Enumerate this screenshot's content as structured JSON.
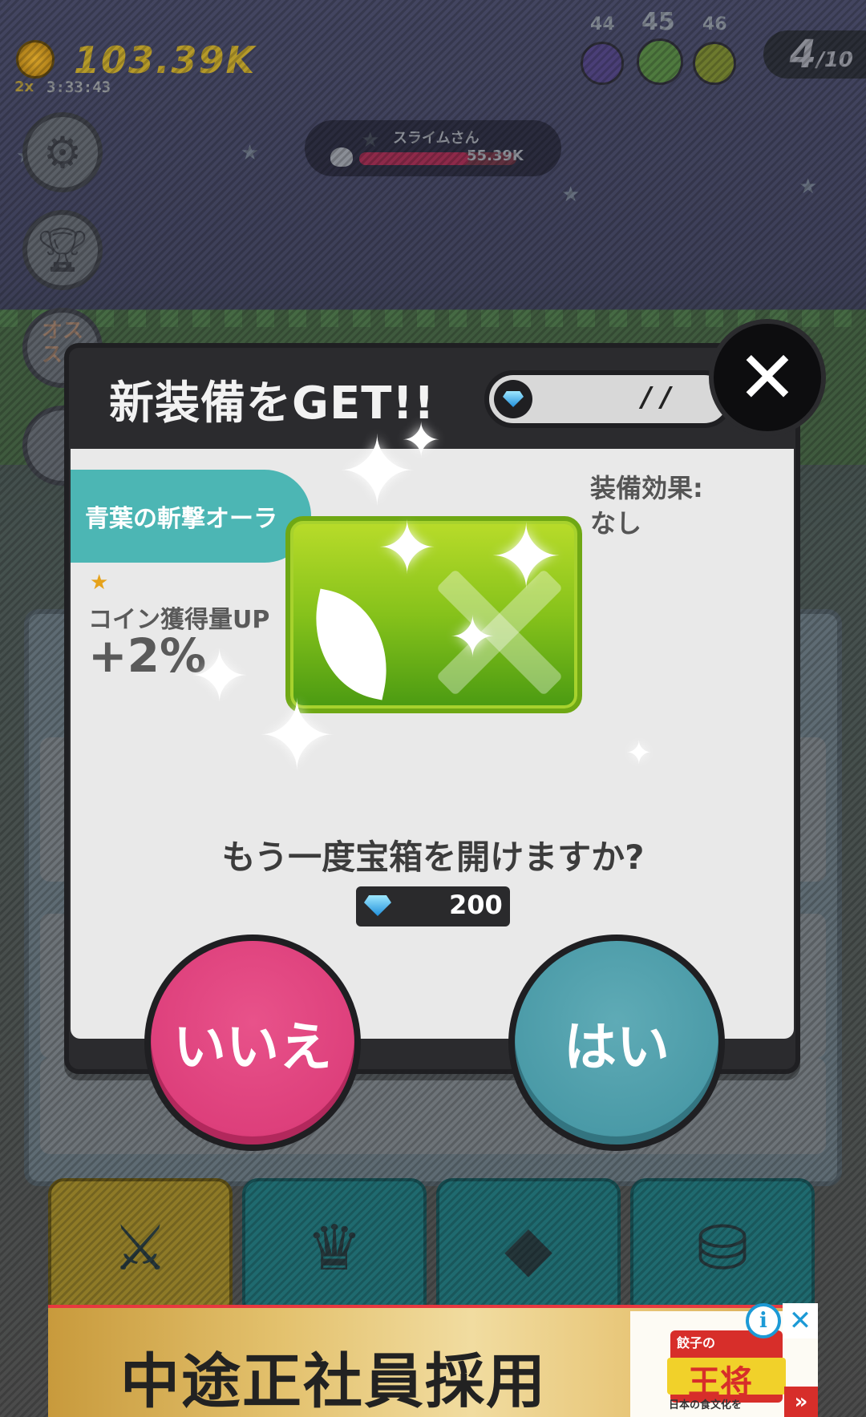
{
  "hud": {
    "coins": "103.39K",
    "multiplier": "2x",
    "timer": "3:33:43",
    "stages": [
      "44",
      "45",
      "46"
    ],
    "stage_colors": [
      "#4a3f77",
      "#4f7a3f",
      "#6d7a2e"
    ],
    "wave_current": "4",
    "wave_total": "/10"
  },
  "enemy": {
    "name": "スライムさん",
    "hp": "55.39K",
    "hp_fraction": 0.7
  },
  "side_menu": {
    "settings_icon": "gear-icon",
    "trophy_icon": "trophy-icon",
    "osusume_label": "オス\nスメ"
  },
  "modal": {
    "title": "新装備をGET!!",
    "gem_count": "/ /",
    "close_label": "✕",
    "item_name": "青葉の斬撃オーラ",
    "bonus_label": "コイン獲得量UP",
    "bonus_value": "+2%",
    "effect_label": "装備効果:",
    "effect_value": "なし",
    "question": "もう一度宝箱を開けますか?",
    "cost": "200",
    "no_label": "いいえ",
    "yes_label": "はい"
  },
  "tabs": [
    {
      "icon": "sword-icon",
      "active": true
    },
    {
      "icon": "party-icon",
      "active": false
    },
    {
      "icon": "crystal-icon",
      "active": false
    },
    {
      "icon": "coin-stack-icon",
      "active": false
    }
  ],
  "ad": {
    "headline": "中途正社員採用",
    "brand": "王将",
    "brand_sub": "餃子の",
    "brand_tagline": "日本の食文化を",
    "info_label": "i",
    "close_label": "✕",
    "arrow_label": "»"
  }
}
